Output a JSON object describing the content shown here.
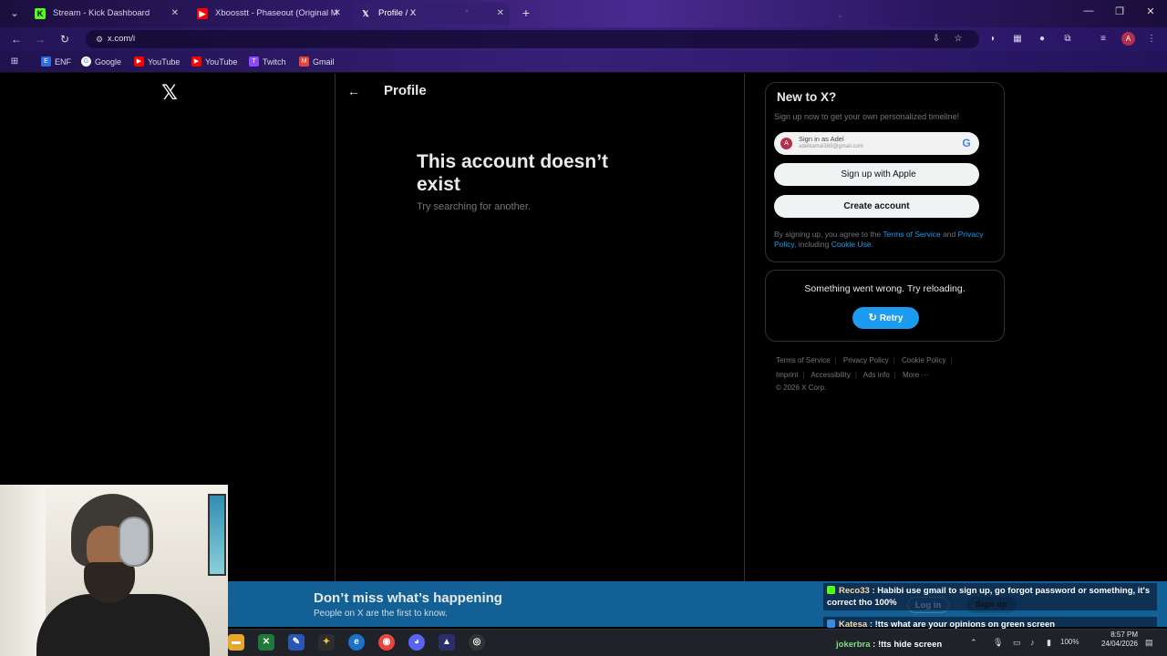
{
  "browser": {
    "tabs": [
      {
        "title": "Stream - Kick Dashboard",
        "favicon": "kick-icon",
        "color": "#53fc18",
        "active": false
      },
      {
        "title": "Xboosstt - Phaseout (Original M",
        "favicon": "youtube-icon",
        "color": "#ff0000",
        "active": false
      },
      {
        "title": "Profile / X",
        "favicon": "x-icon",
        "color": "#ffffff",
        "active": true
      }
    ],
    "url": "x.com/i",
    "profile_initial": "A",
    "bookmarks": [
      {
        "label": "ENF",
        "icon": "enf-icon",
        "color": "#2f6ee0"
      },
      {
        "label": "Google",
        "icon": "google-icon",
        "color": "#4285f4"
      },
      {
        "label": "YouTube",
        "icon": "youtube-icon",
        "color": "#ff0000"
      },
      {
        "label": "YouTube",
        "icon": "youtube-icon",
        "color": "#ff0000"
      },
      {
        "label": "Twitch",
        "icon": "twitch-icon",
        "color": "#9146ff"
      },
      {
        "label": "Gmail",
        "icon": "gmail-icon",
        "color": "#ea4335"
      }
    ]
  },
  "x": {
    "header_title": "Profile",
    "error_title": "This account doesn’t exist",
    "error_subtitle": "Try searching for another.",
    "new_card": {
      "heading": "New to X?",
      "subtext": "Sign up now to get your own personalized timeline!",
      "google_name": "Sign in as Adel",
      "google_email": "adelkamal369@gmail.com",
      "google_initial": "A",
      "apple_label": "Sign up with Apple",
      "create_label": "Create account",
      "terms_prefix": "By signing up, you agree to the ",
      "terms_link": "Terms of Service",
      "terms_and": " and ",
      "privacy_link": "Privacy Policy",
      "including": ", including ",
      "cookie_link": "Cookie Use",
      "period": "."
    },
    "error_card": {
      "message": "Something went wrong. Try reloading.",
      "retry_label": "Retry"
    },
    "footer": {
      "links": [
        "Terms of Service",
        "Privacy Policy",
        "Cookie Policy",
        "Imprint",
        "Accessibility",
        "Ads info",
        "More ···"
      ],
      "copyright": "© 2026 X Corp."
    },
    "banner": {
      "title": "Don’t miss what’s happening",
      "subtitle": "People on X are the first to know.",
      "login_label": "Log in",
      "signup_label": "Sign up"
    },
    "accent": "#1d9bf0"
  },
  "chat": [
    {
      "user": "Reco33",
      "text": ": Habibi use gmail to sign up, go forgot password or something, it's correct tho 100%"
    },
    {
      "user": "Katesa",
      "text": ": !tts what are your opinions on green screen"
    },
    {
      "user": "jokerbra",
      "text": ": !tts hide screen"
    }
  ],
  "taskbar": {
    "battery": "100%",
    "time": "8:57 PM",
    "date": "24/04/2026"
  }
}
